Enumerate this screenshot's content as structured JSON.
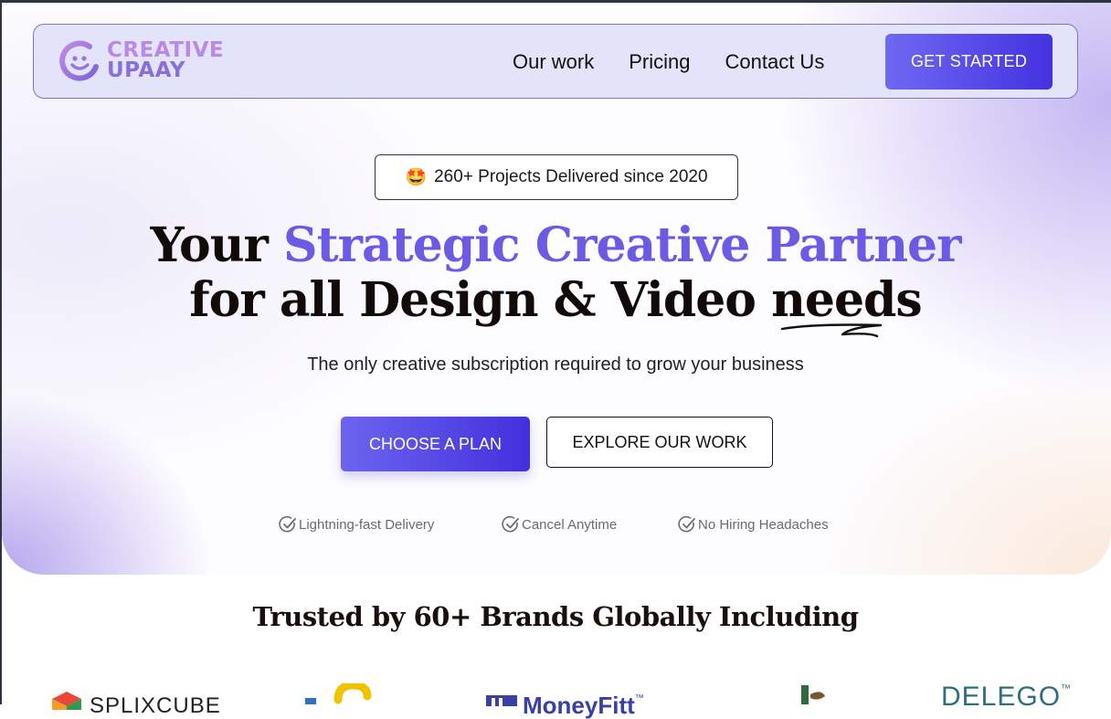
{
  "logo": {
    "line1": "CREATIVE",
    "line2": "UPAAY",
    "icon": "smiley-logo-icon"
  },
  "nav": {
    "links": [
      {
        "label": "Our work"
      },
      {
        "label": "Pricing"
      },
      {
        "label": "Contact Us"
      }
    ],
    "cta_label": "GET STARTED"
  },
  "badge": {
    "emoji": "🤩",
    "text": "260+ Projects Delivered since 2020"
  },
  "headline": {
    "line1_plain": "Your ",
    "line1_accent": "Strategic Creative Partner",
    "line2": "for all Design & Video needs"
  },
  "subheadline": "The only creative subscription required to grow your business",
  "buttons": {
    "primary": "CHOOSE A PLAN",
    "secondary": "EXPLORE OUR WORK"
  },
  "features": [
    {
      "label": "Lightning-fast Delivery",
      "icon": "check-circle-icon"
    },
    {
      "label": "Cancel Anytime",
      "icon": "check-circle-icon"
    },
    {
      "label": "No Hiring Headaches",
      "icon": "check-circle-icon"
    }
  ],
  "trusted_heading": "Trusted by 60+ Brands Globally Including",
  "brands": [
    {
      "name": "SPLIXCUBE"
    },
    {
      "name": "MoneyFitt",
      "mark": "™"
    },
    {
      "name": "DELEGO",
      "mark": "™"
    }
  ],
  "colors": {
    "accent": "#6a5ae4",
    "button_gradient_start": "#6f68f2",
    "button_gradient_end": "#4432e0",
    "nav_bg": "#e3e3fa",
    "logo_pink": "#b889e6",
    "logo_purple": "#8a6fd8"
  }
}
